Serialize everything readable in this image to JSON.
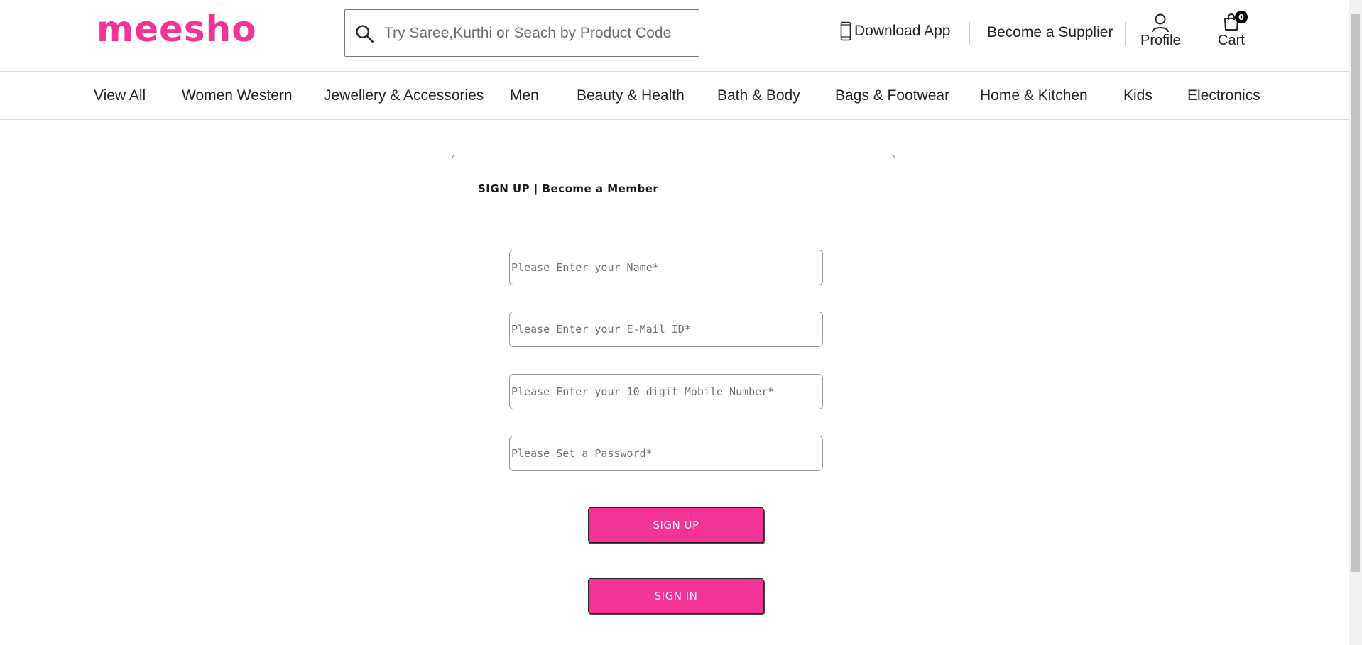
{
  "header": {
    "logo": "meesho",
    "search": {
      "placeholder": "Try Saree,Kurthi or Seach by Product Code",
      "value": ""
    },
    "download_app": "Download App",
    "become_supplier": "Become a Supplier",
    "profile": "Profile",
    "cart": {
      "label": "Cart",
      "count": "0"
    }
  },
  "categories": [
    "View All",
    "Women Western",
    "Jewellery & Accessories",
    "Men",
    "Beauty & Health",
    "Bath & Body",
    "Bags & Footwear",
    "Home & Kitchen",
    "Kids",
    "Electronics"
  ],
  "signup_form": {
    "title": "SIGN UP | Become a Member",
    "fields": [
      {
        "placeholder": "Please Enter your Name*",
        "value": ""
      },
      {
        "placeholder": "Please Enter your E-Mail ID*",
        "value": ""
      },
      {
        "placeholder": "Please Enter your 10 digit Mobile Number*",
        "value": ""
      },
      {
        "placeholder": "Please Set a Password*",
        "value": ""
      }
    ],
    "signup_button": "SIGN UP",
    "signin_button": "SIGN IN"
  },
  "colors": {
    "brand": "#f43397",
    "button_text": "#ffffff",
    "border": "#dcdcdc"
  }
}
